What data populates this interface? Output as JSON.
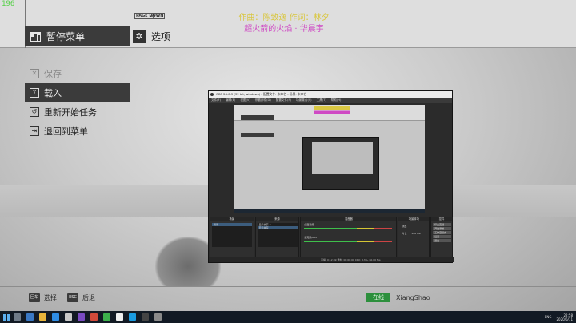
{
  "overlay": {
    "fps": "196"
  },
  "header": {
    "pause_menu_label": "暂停菜单",
    "options_label": "选项",
    "page_down_key": "PAGE DOWN",
    "credits_line1": "作曲：陈致逸 作词：林夕",
    "credits_line2": "超火箭的火焰 · 华晨宇"
  },
  "menu": {
    "items": [
      {
        "label": "保存",
        "icon": "save-icon",
        "state": "disabled"
      },
      {
        "label": "载入",
        "icon": "load-icon",
        "state": "selected"
      },
      {
        "label": "重新开始任务",
        "icon": "restart-icon",
        "state": "normal"
      },
      {
        "label": "退回到菜单",
        "icon": "exit-icon",
        "state": "normal"
      }
    ]
  },
  "obs": {
    "title": "OBS 24.0.3 (32 bit, windows) - 配置文件: 未命名 - 场景: 未命名",
    "menu": [
      "文件(F)",
      "编辑(E)",
      "视图(V)",
      "停靠部件(D)",
      "配置文件(P)",
      "场景集合(S)",
      "工具(T)",
      "帮助(H)"
    ],
    "docks": {
      "scenes": "场景",
      "sources": "来源",
      "mixer": "混音器",
      "transitions": "场景转场",
      "controls": "控件"
    },
    "scene_items": [
      "场景"
    ],
    "source_items": [
      "显示捕获 2",
      "显示捕获"
    ],
    "mixer_tracks": [
      "桌面音频",
      "麦克风/Aux"
    ],
    "control_buttons": [
      "停止直播",
      "开始录制",
      "工作室模式",
      "设置",
      "退出"
    ],
    "transition_label": "淡出",
    "duration_label": "时长",
    "duration_value": "300 ms",
    "status": "直播: 0:12:49   录制: 00:00:00   CPU: 3.3%, 60.00 fps"
  },
  "footer": {
    "hints": [
      {
        "key": "回车",
        "label": "选择"
      },
      {
        "key": "ESC",
        "label": "后退"
      }
    ],
    "online_status": "在线",
    "username": "XiangShao"
  },
  "taskbar": {
    "tray_lang": "ENG",
    "time": "22:58",
    "date": "2020/6/11"
  },
  "colors": {
    "menu_dark": "#3b3b3b",
    "credits_yellow": "#d9c742",
    "credits_magenta": "#cf4ac4",
    "online_green": "#2c8f3c",
    "taskbar": "#121a24"
  }
}
